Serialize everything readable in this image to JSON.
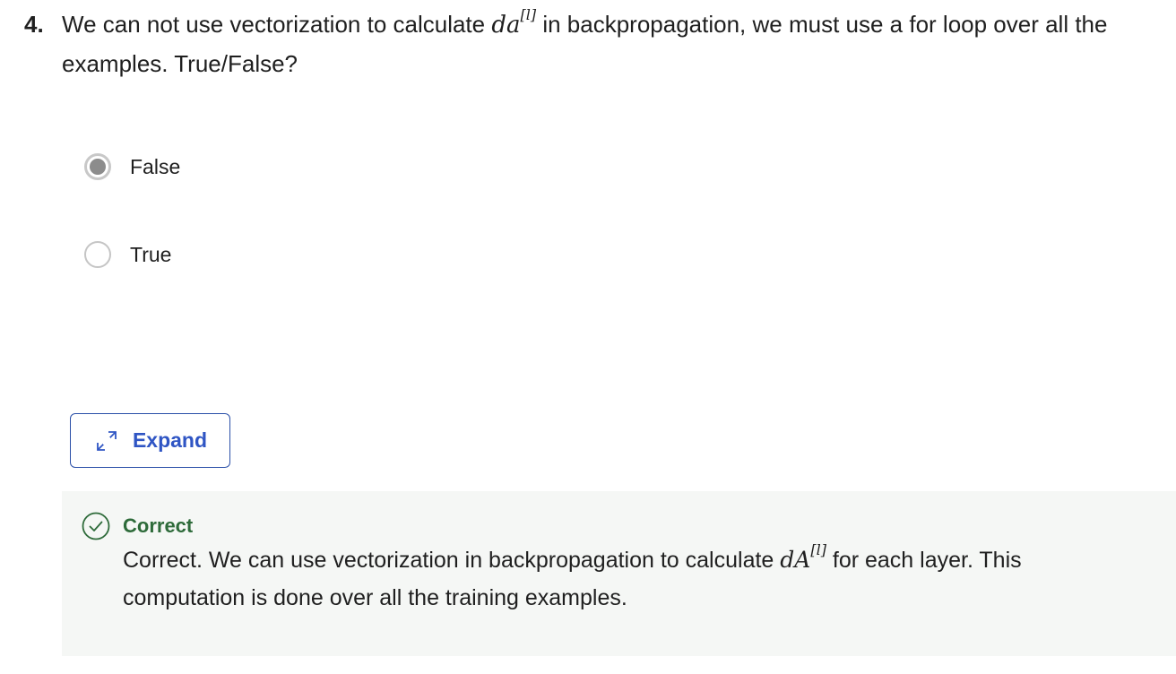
{
  "question": {
    "number": "4.",
    "text_before": "We can not use vectorization to calculate ",
    "math_base": "da",
    "math_sup": "[l]",
    "text_after": " in backpropagation, we must use a for loop over all the examples. True/False?"
  },
  "options": [
    {
      "label": "False",
      "selected": true
    },
    {
      "label": "True",
      "selected": false
    }
  ],
  "expand_label": "Expand",
  "feedback": {
    "title": "Correct",
    "text_before": "Correct. We can use vectorization in backpropagation to calculate ",
    "math_base": "dA",
    "math_sup": "[l]",
    "text_after": " for each layer. This computation is done over all the training examples."
  },
  "colors": {
    "accent": "#2f55c4",
    "success": "#2e6b3a",
    "feedback_bg": "#f5f7f5"
  },
  "icons": {
    "expand": "expand-arrows-icon",
    "correct": "check-circle-icon"
  }
}
